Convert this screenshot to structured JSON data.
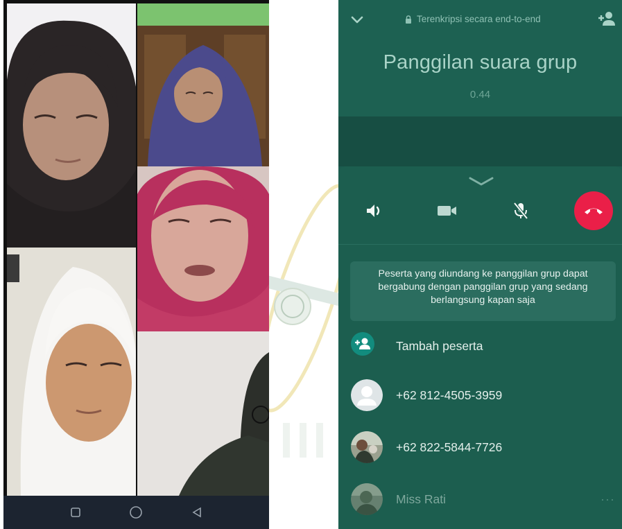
{
  "left_phone": {
    "tiles": [
      {
        "label": "participant-1"
      },
      {
        "label": "participant-2"
      },
      {
        "label": "participant-3"
      },
      {
        "label": "participant-4"
      },
      {
        "label": "participant-5"
      }
    ],
    "nav_icons": [
      "square-icon",
      "circle-icon",
      "triangle-back-icon"
    ]
  },
  "call": {
    "encryption_text": "Terenkripsi secara end-to-end",
    "title": "Panggilan suara grup",
    "timer": "0.44",
    "controls": [
      "speaker-icon",
      "video-icon",
      "mic-off-icon",
      "end-call-icon"
    ],
    "info_text": "Peserta yang diundang ke panggilan grup dapat bergabung dengan panggilan grup yang sedang berlangsung kapan saja",
    "add_participant_label": "Tambah peserta",
    "participants": [
      {
        "name": "+62 812-4505-3959"
      },
      {
        "name": "+62 822-5844-7726"
      },
      {
        "name": "Miss Rati",
        "more": "···"
      }
    ],
    "colors": {
      "background": "#1b5b4e",
      "end_call": "#ea1f48",
      "accent": "#128c7e"
    }
  }
}
